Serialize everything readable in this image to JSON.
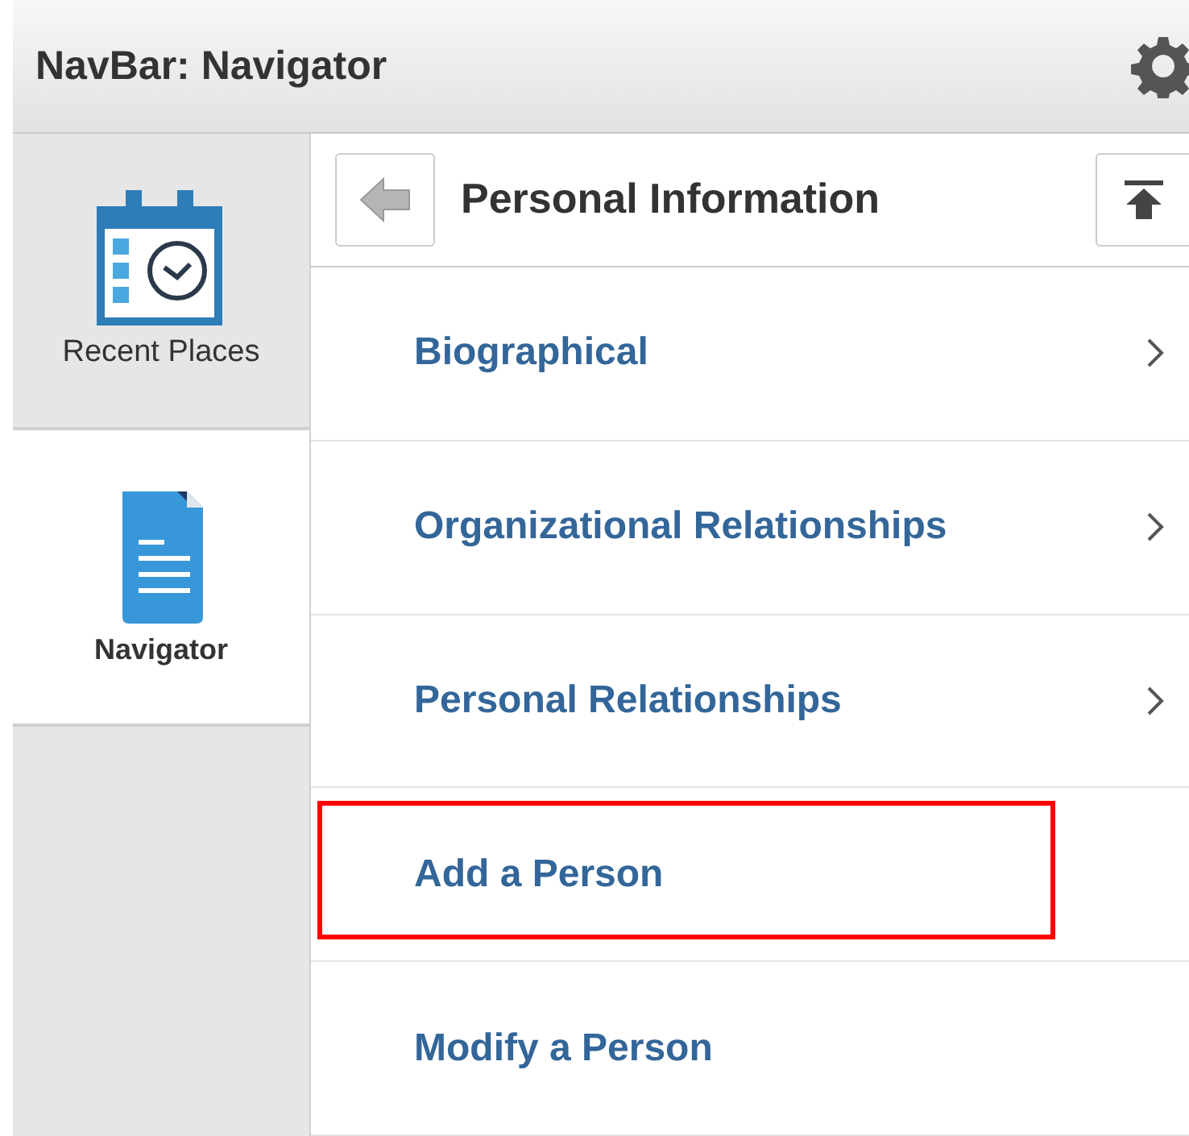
{
  "header": {
    "title": "NavBar: Navigator"
  },
  "sidebar": {
    "items": [
      {
        "label": "Recent Places",
        "kind": "recent",
        "selected": false
      },
      {
        "label": "Navigator",
        "kind": "navigator",
        "selected": true
      }
    ]
  },
  "panel": {
    "title": "Personal Information",
    "items": [
      {
        "label": "Biographical",
        "kind": "folder",
        "highlighted": false
      },
      {
        "label": "Organizational Relationships",
        "kind": "folder",
        "highlighted": false
      },
      {
        "label": "Personal Relationships",
        "kind": "folder",
        "highlighted": false
      },
      {
        "label": "Add a Person",
        "kind": "link",
        "highlighted": true
      },
      {
        "label": "Modify a Person",
        "kind": "link",
        "highlighted": false
      }
    ]
  }
}
